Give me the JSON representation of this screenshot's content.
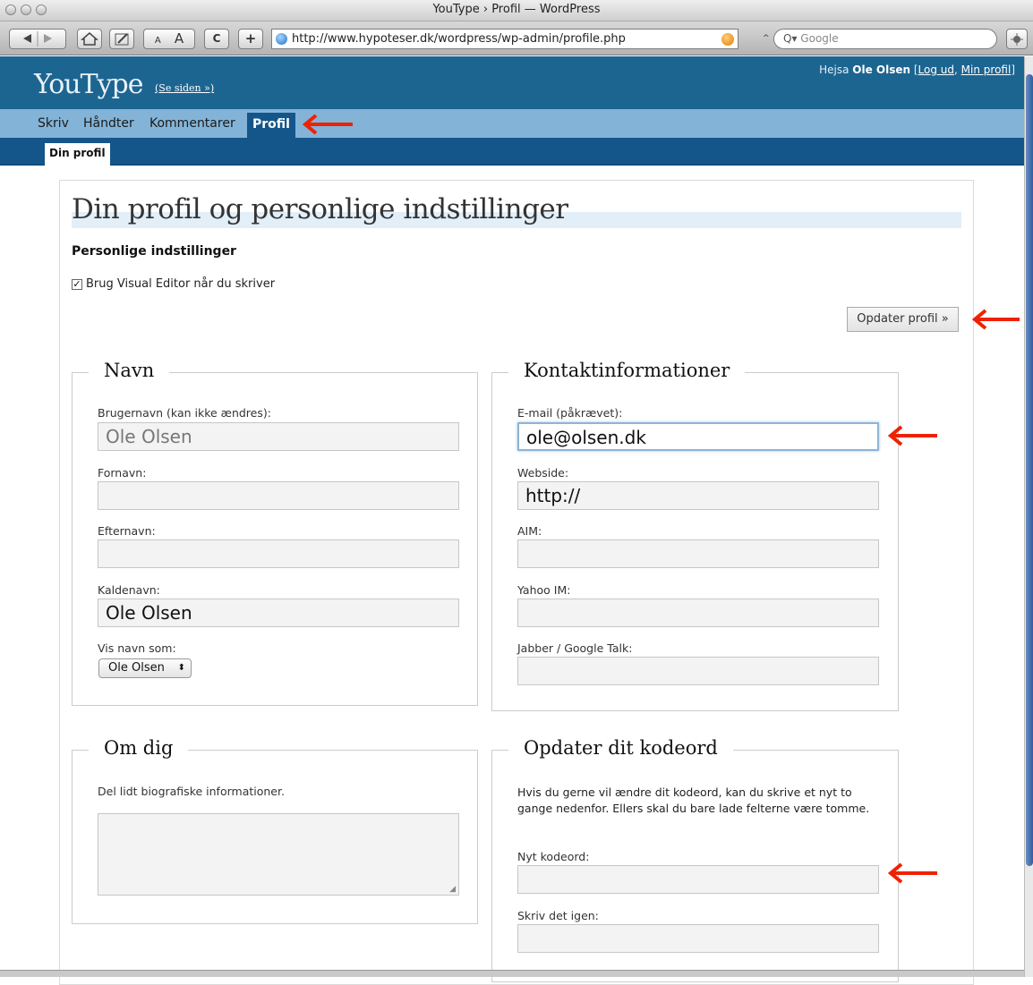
{
  "browser": {
    "window_title": "YouType › Profil — WordPress",
    "url": "http://www.hypoteser.dk/wordpress/wp-admin/profile.php",
    "search_placeholder": "Google",
    "text_small": "A",
    "text_large": "A",
    "reload_icon": "C",
    "add_icon": "+"
  },
  "header": {
    "site_title": "YouType",
    "view_site": "(Se siden »)",
    "greeting_prefix": "Hejsa",
    "username": "Ole Olsen",
    "logout": "Log ud",
    "my_profile": "Min profil"
  },
  "nav": {
    "items": [
      "Skriv",
      "Håndter",
      "Kommentarer",
      "Profil"
    ],
    "active": "Profil",
    "sub_item": "Din profil"
  },
  "page": {
    "title": "Din profil og personlige indstillinger",
    "personal_heading": "Personlige indstillinger",
    "visual_editor_label": "Brug Visual Editor når du skriver",
    "visual_editor_checked": true,
    "update_button": "Opdater profil »"
  },
  "name_section": {
    "legend": "Navn",
    "username_label": "Brugernavn (kan ikke ændres):",
    "username_value": "Ole Olsen",
    "firstname_label": "Fornavn:",
    "firstname_value": "",
    "lastname_label": "Efternavn:",
    "lastname_value": "",
    "nickname_label": "Kaldenavn:",
    "nickname_value": "Ole Olsen",
    "display_label": "Vis navn som:",
    "display_value": "Ole Olsen"
  },
  "contact_section": {
    "legend": "Kontaktinformationer",
    "email_label": "E-mail (påkrævet):",
    "email_value": "ole@olsen.dk",
    "website_label": "Webside:",
    "website_value": "http://",
    "aim_label": "AIM:",
    "aim_value": "",
    "yahoo_label": "Yahoo IM:",
    "yahoo_value": "",
    "jabber_label": "Jabber / Google Talk:",
    "jabber_value": ""
  },
  "about_section": {
    "legend": "Om dig",
    "description": "Del lidt biografiske informationer.",
    "bio_value": ""
  },
  "password_section": {
    "legend": "Opdater dit kodeord",
    "instructions": "Hvis du gerne vil ændre dit kodeord, kan du skrive et nyt to gange nedenfor. Ellers skal du bare lade felterne være tomme.",
    "new_password_label": "Nyt kodeord:",
    "repeat_label": "Skriv det igen:"
  },
  "annotation_color": "#ee2200"
}
